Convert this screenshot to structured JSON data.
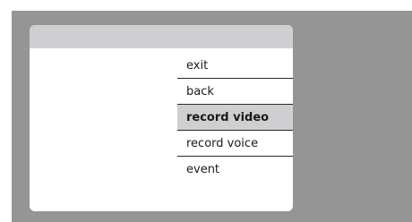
{
  "menu": {
    "items": [
      {
        "label": "exit",
        "selected": false
      },
      {
        "label": "back",
        "selected": false
      },
      {
        "label": "record video",
        "selected": true
      },
      {
        "label": "record voice",
        "selected": false
      },
      {
        "label": "event",
        "selected": false
      }
    ]
  },
  "colors": {
    "background": "#959595",
    "panel": "#ffffff",
    "header": "#cfcfd1",
    "selected": "#cfcfd1"
  }
}
